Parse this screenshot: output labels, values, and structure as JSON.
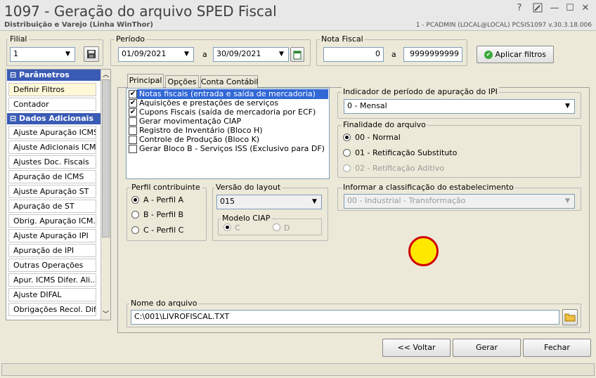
{
  "window": {
    "title": "1097 - Geração do arquivo SPED Fiscal",
    "subtitle": "Distribuição e Varejo (Linha WinThor)",
    "user_info": "1 - PCADMIN (LOCAL@LOCAL)   PCSIS1097  v.30.3.18.006",
    "help": "?",
    "min": "—",
    "max": "☐",
    "close": "✕"
  },
  "filial": {
    "label": "Filial",
    "value": "1"
  },
  "periodo": {
    "label": "Período",
    "start": "01/09/2021",
    "sep": "a",
    "end": "30/09/2021"
  },
  "nota_fiscal": {
    "label": "Nota Fiscal",
    "start": "0",
    "sep": "a",
    "end": "9999999999"
  },
  "apply_button": "Aplicar filtros",
  "sidebar": {
    "parametros_header": "Parâmetros",
    "parametros": [
      "Definir Filtros",
      "Contador"
    ],
    "dados_header": "Dados Adicionais",
    "dados": [
      "Ajuste Apuração ICMS",
      "Ajuste Adicionais ICMS",
      "Ajustes Doc. Fiscais",
      "Apuração de ICMS",
      "Ajuste Apuração ST",
      "Apuração de ST",
      "Obrig. Apuração ICM...",
      "Ajuste Apuração IPI",
      "Apuração de IPI",
      "Outras Operações",
      "Apur. ICMS Difer. Ali...",
      "Ajuste DIFAL",
      "Obrigações Recol. Difal"
    ]
  },
  "tabs": [
    "Principal",
    "Opções",
    "Conta Contábil"
  ],
  "checklist": [
    {
      "label": "Notas fiscais (entrada e saída de mercadoria)",
      "checked": "✔"
    },
    {
      "label": "Aquisições e prestações de serviços",
      "checked": "✔"
    },
    {
      "label": "Cupons Fiscais (saída de mercadoria por ECF)",
      "checked": "✔"
    },
    {
      "label": "Gerar movimentação CIAP",
      "checked": ""
    },
    {
      "label": "Registro de Inventário (Bloco H)",
      "checked": ""
    },
    {
      "label": "Controle de Produção (Bloco K)",
      "checked": ""
    },
    {
      "label": "Gerar Bloco B - Serviços ISS (Exclusivo para DF)",
      "checked": ""
    }
  ],
  "ipi": {
    "label": "Indicador de período de apuração do IPI",
    "value": "0 - Mensal"
  },
  "finalidade": {
    "label": "Finalidade do arquivo",
    "options": [
      "00 - Normal",
      "01 - Retificação Substituto",
      "02 - Retificação Aditivo"
    ]
  },
  "perfil": {
    "label": "Perfil contribuinte",
    "options": [
      "A - Perfil A",
      "B - Perfil B",
      "C - Perfil C"
    ]
  },
  "versao": {
    "label": "Versão do layout",
    "value": "015"
  },
  "ciap": {
    "label": "Modelo CIAP",
    "options": [
      "C",
      "D"
    ]
  },
  "classificacao": {
    "label": "Informar a classificação do estabelecimento",
    "value": "00 - Industrial - Transformação"
  },
  "arquivo": {
    "label": "Nome do arquivo",
    "value": "C:\\001\\LIVROFISCAL.TXT"
  },
  "buttons": {
    "back": "<< Voltar",
    "generate": "Gerar",
    "close": "Fechar"
  },
  "colors": {
    "sidebar_header": "#3a5bb5",
    "selection": "#3168d5",
    "cursor_ring": "#d00000",
    "cursor_fill": "#ffe800"
  }
}
